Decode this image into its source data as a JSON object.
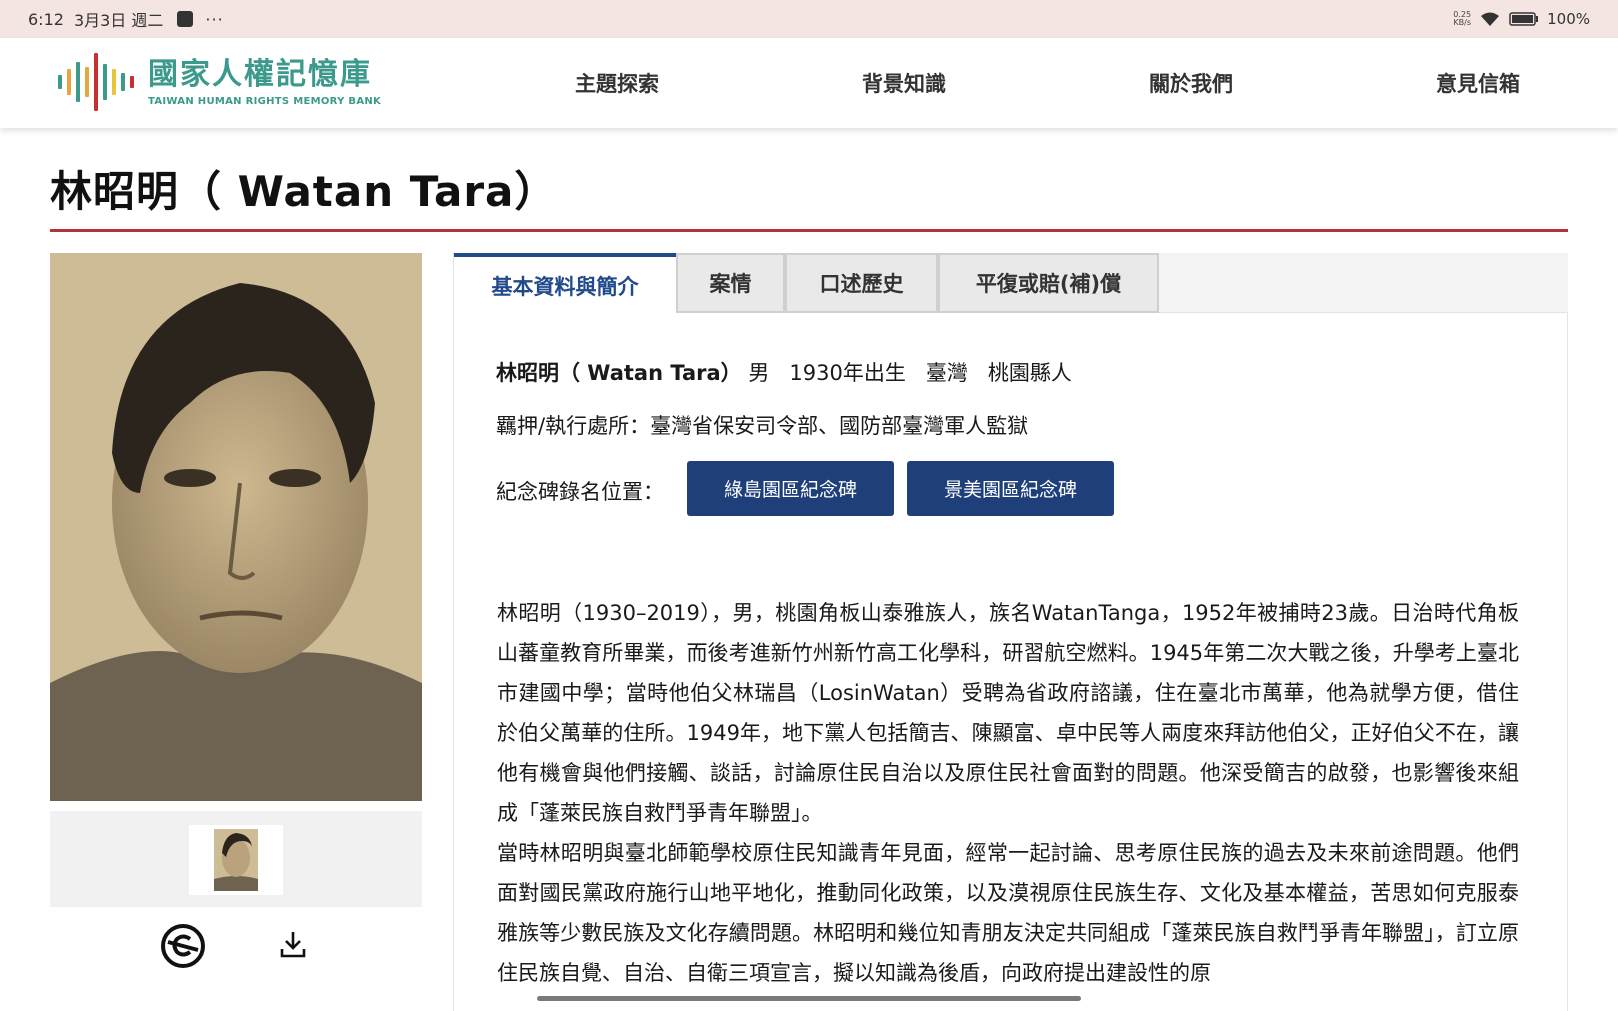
{
  "status_bar": {
    "time": "6:12",
    "date": "3月3日 週二",
    "overflow": "···",
    "net_speed_value": "0.25",
    "net_speed_unit": "KB/s",
    "battery": "100%"
  },
  "header": {
    "logo_zh": "國家人權記憶庫",
    "logo_en": "TAIWAN HUMAN RIGHTS MEMORY BANK",
    "logo_bar_colors": [
      "#3b9a8b",
      "#e7a63a",
      "#3b9a8b",
      "#e7a63a",
      "#c7302f",
      "#3b9a8b",
      "#e7c63a",
      "#3b9a8b",
      "#c7302f"
    ],
    "nav": [
      {
        "label": "主題探索"
      },
      {
        "label": "背景知識"
      },
      {
        "label": "關於我們"
      },
      {
        "label": "意見信箱"
      }
    ]
  },
  "page": {
    "title": "林昭明（ Watan Tara）",
    "accent_color": "#b2333a"
  },
  "tabs": [
    {
      "label": "基本資料與簡介",
      "active": true
    },
    {
      "label": "案情",
      "active": false
    },
    {
      "label": "口述歷史",
      "active": false
    },
    {
      "label": "平復或賠(補)償",
      "active": false
    }
  ],
  "profile": {
    "name": "林昭明（ Watan Tara）",
    "gender": "男",
    "born": "1930年出生",
    "origin_region": "臺灣",
    "origin_county": "桃園縣人",
    "detention_label": "羈押/執行處所：",
    "detention_value": "臺灣省保安司令部、國防部臺灣軍人監獄",
    "memorial_label": "紀念碑錄名位置：",
    "memorial_buttons": [
      "綠島園區紀念碑",
      "景美園區紀念碑"
    ]
  },
  "bio": {
    "p1": "林昭明（1930–2019），男，桃園角板山泰雅族人，族名WatanTanga，1952年被捕時23歲。日治時代角板山蕃童教育所畢業，而後考進新竹州新竹高工化學科，研習航空燃料。1945年第二次大戰之後，升學考上臺北市建國中學；當時他伯父林瑞昌（LosinWatan）受聘為省政府諮議，住在臺北市萬華，他為就學方便，借住於伯父萬華的住所。1949年，地下黨人包括簡吉、陳顯富、卓中民等人兩度來拜訪他伯父，正好伯父不在，讓他有機會與他們接觸、談話，討論原住民自治以及原住民社會面對的問題。他深受簡吉的啟發，也影響後來組成「蓬萊民族自救鬥爭青年聯盟」。",
    "p2": "當時林昭明與臺北師範學校原住民知識青年見面，經常一起討論、思考原住民族的過去及未來前途問題。他們面對國民黨政府施行山地平地化，推動同化政策，以及漠視原住民族生存、文化及基本權益，苦思如何克服泰雅族等少數民族及文化存續問題。林昭明和幾位知青朋友決定共同組成「蓬萊民族自救鬥爭青年聯盟」，訂立原住民族自覺、自治、自衛三項宣言，擬以知識為後盾，向政府提出建設性的原"
  },
  "icons": {
    "copyright": "no-copyright-icon",
    "download": "download-icon"
  }
}
